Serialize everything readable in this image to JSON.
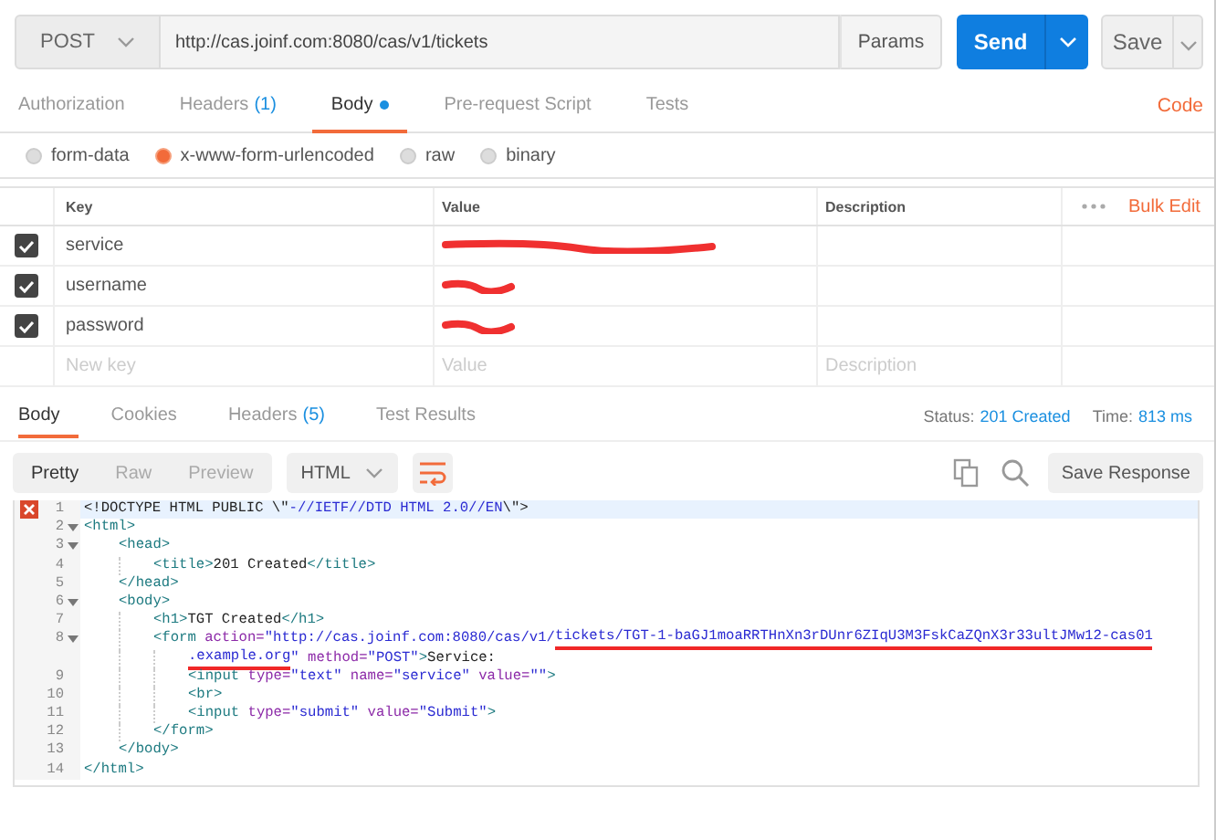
{
  "request": {
    "method": "POST",
    "url": "http://cas.joinf.com:8080/cas/v1/tickets",
    "params_button": "Params",
    "send_button": "Send",
    "save_button": "Save"
  },
  "request_tabs": [
    {
      "label": "Authorization",
      "selected": false
    },
    {
      "label": "Headers",
      "count": "(1)",
      "selected": false
    },
    {
      "label": "Body",
      "dot": true,
      "selected": true
    },
    {
      "label": "Pre-request Script",
      "selected": false
    },
    {
      "label": "Tests",
      "selected": false
    }
  ],
  "code_link": "Code",
  "body_modes": [
    {
      "label": "form-data",
      "selected": false
    },
    {
      "label": "x-www-form-urlencoded",
      "selected": true
    },
    {
      "label": "raw",
      "selected": false
    },
    {
      "label": "binary",
      "selected": false
    }
  ],
  "params_table": {
    "columns": [
      "Key",
      "Value",
      "Description"
    ],
    "bulk_edit": "Bulk Edit",
    "rows": [
      {
        "key": "service",
        "checked": true,
        "redacted": true
      },
      {
        "key": "username",
        "checked": true,
        "redacted": true
      },
      {
        "key": "password",
        "checked": true,
        "redacted": true
      }
    ],
    "new_row": {
      "key_placeholder": "New key",
      "value_placeholder": "Value",
      "description_placeholder": "Description"
    }
  },
  "response_tabs": [
    {
      "label": "Body",
      "selected": true
    },
    {
      "label": "Cookies",
      "selected": false
    },
    {
      "label": "Headers",
      "count": "(5)",
      "selected": false
    },
    {
      "label": "Test Results",
      "selected": false
    }
  ],
  "status": {
    "label": "Status:",
    "value": "201 Created",
    "time_label": "Time:",
    "time_value": "813 ms"
  },
  "view_modes": [
    {
      "label": "Pretty",
      "selected": true
    },
    {
      "label": "Raw",
      "selected": false
    },
    {
      "label": "Preview",
      "selected": false
    }
  ],
  "format": "HTML",
  "wrap_on": true,
  "save_response": "Save Response",
  "code_lines": [
    {
      "num": "1",
      "error": true,
      "highlighted": true,
      "parts": [
        {
          "tokens": [
            {
              "kind": "text",
              "text": "<!DOCTYPE HTML PUBLIC \\\""
            },
            {
              "kind": "str",
              "text": "-//IETF//DTD HTML 2.0//EN"
            },
            {
              "kind": "text",
              "text": "\\\">"
            }
          ]
        }
      ]
    },
    {
      "num": "2",
      "expanded": true,
      "parts": [
        {
          "tokens": [
            {
              "kind": "tag",
              "text": "<html>"
            }
          ]
        }
      ],
      "children": [
        {
          "num": "3",
          "expanded": true,
          "parts": [
            {
              "tokens": [
                {
                  "kind": "tag",
                  "text": "<head>"
                }
              ]
            }
          ],
          "children": [
            {
              "num": "4",
              "parts": [
                {
                  "tokens": [
                    {
                      "kind": "tag",
                      "text": "<title>"
                    },
                    {
                      "kind": "text",
                      "text": "201 Created"
                    },
                    {
                      "kind": "tag",
                      "text": "</title>"
                    }
                  ]
                }
              ]
            }
          ]
        },
        {
          "num": "5",
          "parts": [
            {
              "tokens": [
                {
                  "kind": "tag",
                  "text": "</head>"
                }
              ]
            }
          ]
        },
        {
          "num": "6",
          "expanded": true,
          "parts": [
            {
              "tokens": [
                {
                  "kind": "tag",
                  "text": "<body>"
                }
              ]
            }
          ],
          "children": [
            {
              "num": "7",
              "parts": [
                {
                  "tokens": [
                    {
                      "kind": "tag",
                      "text": "<h1>"
                    },
                    {
                      "kind": "text",
                      "text": "TGT Created"
                    },
                    {
                      "kind": "tag",
                      "text": "</h1>"
                    }
                  ]
                }
              ]
            },
            {
              "num": "8",
              "expanded": true,
              "parts": [
                {
                  "tokens": [
                    {
                      "kind": "tag",
                      "text": "<form "
                    },
                    {
                      "kind": "attr",
                      "text": "action="
                    },
                    {
                      "kind": "str",
                      "text": "\"http://cas.joinf.com:8080/cas/v1/"
                    },
                    {
                      "kind": "str",
                      "text": "tickets/TGT-1-baGJ1moaRRTHnXn3rDUnr6ZIqU3M3FskCaZQnX3r33ultJMw12-cas01",
                      "scribbled": true
                    }
                  ]
                },
                {
                  "tokens": [
                    {
                      "kind": "str",
                      "text": ".example.org",
                      "scribbled": true
                    },
                    {
                      "kind": "str",
                      "text": "\""
                    },
                    {
                      "kind": "attr",
                      "text": " method="
                    },
                    {
                      "kind": "str",
                      "text": "\"POST\""
                    },
                    {
                      "kind": "tag",
                      "text": ">"
                    },
                    {
                      "kind": "text",
                      "text": "Service:"
                    }
                  ]
                }
              ],
              "children": [
                {
                  "num": "9",
                  "parts": [
                    {
                      "tokens": [
                        {
                          "kind": "tag",
                          "text": "<input "
                        },
                        {
                          "kind": "attr",
                          "text": "type="
                        },
                        {
                          "kind": "str",
                          "text": "\"text\""
                        },
                        {
                          "kind": "attr",
                          "text": " name="
                        },
                        {
                          "kind": "str",
                          "text": "\"service\""
                        },
                        {
                          "kind": "attr",
                          "text": " value="
                        },
                        {
                          "kind": "str",
                          "text": "\"\""
                        },
                        {
                          "kind": "tag",
                          "text": ">"
                        }
                      ]
                    }
                  ]
                },
                {
                  "num": "10",
                  "parts": [
                    {
                      "tokens": [
                        {
                          "kind": "tag",
                          "text": "<br>"
                        }
                      ]
                    }
                  ]
                },
                {
                  "num": "11",
                  "parts": [
                    {
                      "tokens": [
                        {
                          "kind": "tag",
                          "text": "<input "
                        },
                        {
                          "kind": "attr",
                          "text": "type="
                        },
                        {
                          "kind": "str",
                          "text": "\"submit\""
                        },
                        {
                          "kind": "attr",
                          "text": " value="
                        },
                        {
                          "kind": "str",
                          "text": "\"Submit\""
                        },
                        {
                          "kind": "tag",
                          "text": ">"
                        }
                      ]
                    }
                  ]
                }
              ]
            },
            {
              "num": "12",
              "parts": [
                {
                  "tokens": [
                    {
                      "kind": "tag",
                      "text": "</form>"
                    }
                  ]
                }
              ]
            }
          ]
        },
        {
          "num": "13",
          "parts": [
            {
              "tokens": [
                {
                  "kind": "tag",
                  "text": "</body>"
                }
              ]
            }
          ]
        }
      ]
    },
    {
      "num": "14",
      "parts": [
        {
          "tokens": [
            {
              "kind": "tag",
              "text": "</html>"
            }
          ]
        }
      ]
    }
  ]
}
